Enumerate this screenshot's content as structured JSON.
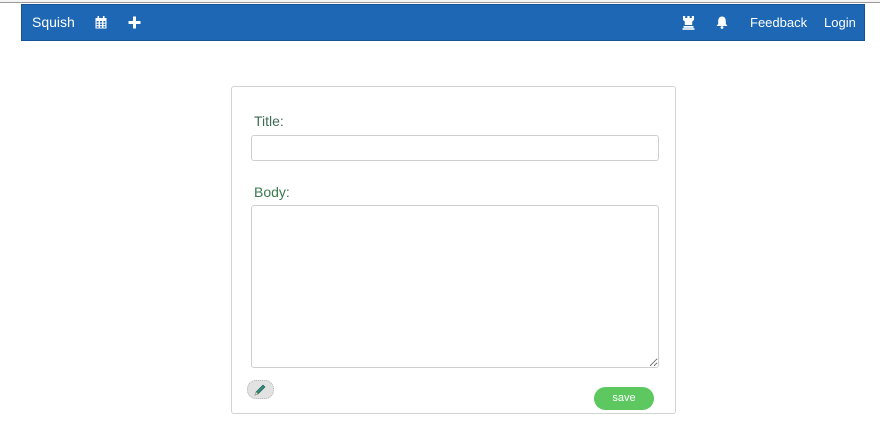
{
  "navbar": {
    "brand": "Squish",
    "left_icons": [
      "calendar-icon",
      "plus-icon"
    ],
    "right_icons": [
      "rook-icon",
      "bell-icon"
    ],
    "feedback_label": "Feedback",
    "login_label": "Login",
    "background_color": "#1d67b5"
  },
  "form": {
    "title_label": "Title:",
    "title_value": "",
    "body_label": "Body:",
    "body_value": "",
    "edit_icon": "pencil-icon",
    "save_label": "save",
    "save_color": "#5cc85f"
  }
}
